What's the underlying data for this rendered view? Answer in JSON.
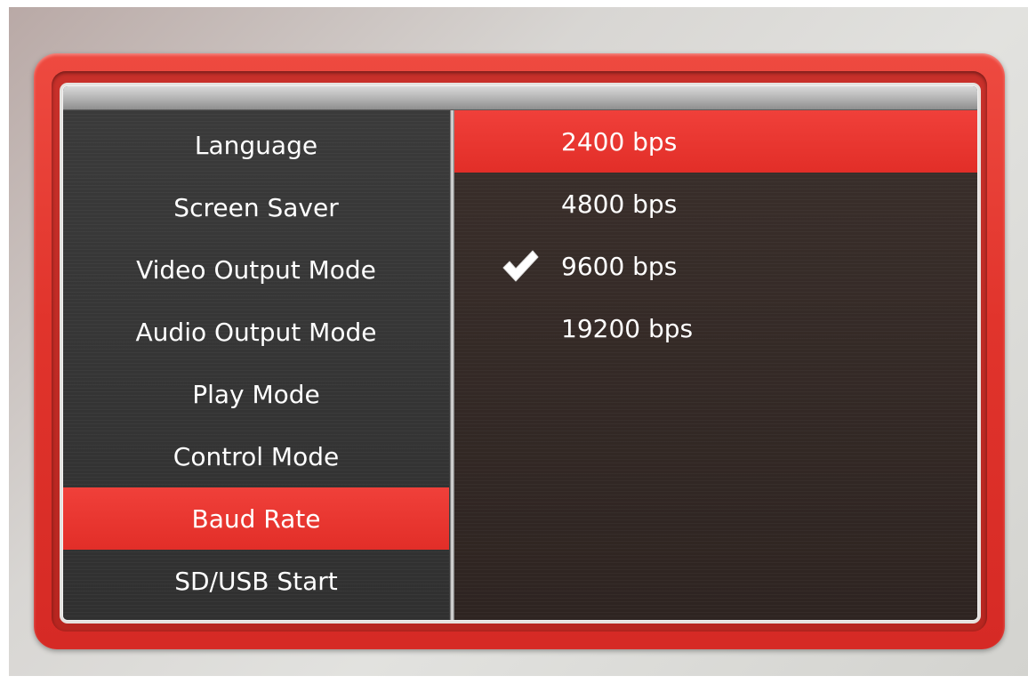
{
  "settings_menu": {
    "items": [
      {
        "label": "Language"
      },
      {
        "label": "Screen Saver"
      },
      {
        "label": "Video Output Mode"
      },
      {
        "label": "Audio Output Mode"
      },
      {
        "label": "Play Mode"
      },
      {
        "label": "Control Mode"
      },
      {
        "label": "Baud Rate",
        "selected": true
      },
      {
        "label": "SD/USB Start"
      }
    ]
  },
  "baud_rate_options": {
    "items": [
      {
        "label": "2400 bps",
        "highlighted": true
      },
      {
        "label": "4800 bps"
      },
      {
        "label": "9600 bps",
        "checked": true,
        "icon": "checkmark-icon"
      },
      {
        "label": "19200 bps"
      }
    ]
  },
  "colors": {
    "accent_red": "#e8352f",
    "frame_red": "#dc302a",
    "panel_dark": "#2e2a28",
    "text": "#ffffff"
  }
}
